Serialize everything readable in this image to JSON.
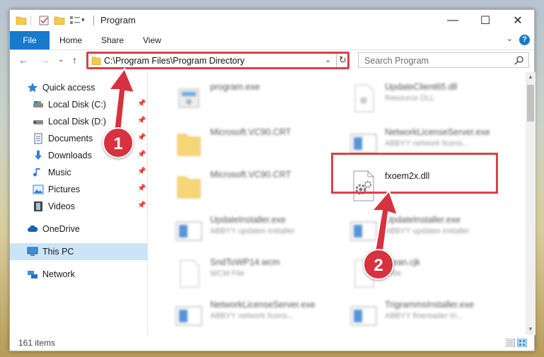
{
  "window": {
    "title": "Program",
    "controls": {
      "minimize": "—",
      "maximize": "☐",
      "close": "✕"
    }
  },
  "ribbon": {
    "tabs": [
      "File",
      "Home",
      "Share",
      "View"
    ],
    "help": "?"
  },
  "address": {
    "path": "C:\\Program Files\\Program Directory",
    "dropdown": "⌄",
    "refresh": "↻"
  },
  "search": {
    "placeholder": "Search Program"
  },
  "nav": {
    "back": "←",
    "forward": "→",
    "recent": "⌄",
    "up": "↑"
  },
  "sidebar": {
    "items": [
      {
        "label": "Quick access",
        "icon": "star-icon"
      },
      {
        "label": "Local Disk (C:)",
        "icon": "drive-icon",
        "pinned": true
      },
      {
        "label": "Local Disk (D:)",
        "icon": "drive-icon",
        "pinned": true
      },
      {
        "label": "Documents",
        "icon": "documents-icon",
        "pinned": true
      },
      {
        "label": "Downloads",
        "icon": "downloads-icon",
        "pinned": true
      },
      {
        "label": "Music",
        "icon": "music-icon",
        "pinned": true
      },
      {
        "label": "Pictures",
        "icon": "pictures-icon",
        "pinned": true
      },
      {
        "label": "Videos",
        "icon": "videos-icon",
        "pinned": true
      },
      {
        "label": "OneDrive",
        "icon": "cloud-icon"
      },
      {
        "label": "This PC",
        "icon": "computer-icon",
        "selected": true
      },
      {
        "label": "Network",
        "icon": "network-icon"
      }
    ]
  },
  "files": [
    {
      "name": "program.exe",
      "sub": "",
      "icon": "exe-icon"
    },
    {
      "name": "UpdateClient65.dll",
      "sub": "Resource DLL",
      "icon": "dll-icon"
    },
    {
      "name": "Microsoft.VC90.CRT",
      "sub": "",
      "icon": "folder-icon"
    },
    {
      "name": "NetworkLicenseServer.exe",
      "sub": "ABBYY network licens...",
      "icon": "app-icon"
    },
    {
      "name": "Microsoft.VC90.CRT",
      "sub": "",
      "icon": "folder-icon"
    },
    {
      "name": "fxoem2x.dll",
      "sub": "",
      "icon": "dll-gear-icon"
    },
    {
      "name": "UpdateInstaller.exe",
      "sub": "ABBYY updates installer",
      "icon": "app-icon"
    },
    {
      "name": "UpdateInstaller.exe",
      "sub": "ABBYY updates installer",
      "icon": "app-icon"
    },
    {
      "name": "SndToWP14.wcm",
      "sub": "WCM File",
      "icon": "file-icon"
    },
    {
      "name": "...ean.cjk",
      "sub": "...file",
      "icon": "file-icon"
    },
    {
      "name": "NetworkLicenseServer.exe",
      "sub": "ABBYY network licens...",
      "icon": "app-icon"
    },
    {
      "name": "TrigrammsInstaller.exe",
      "sub": "ABBYY finereader tri...",
      "icon": "app-icon"
    }
  ],
  "status": {
    "count": "161 items"
  },
  "annotations": {
    "step1": "1",
    "step2": "2"
  },
  "colors": {
    "accent": "#1979ca",
    "annotation": "#d9414b",
    "selection": "#cce4f7"
  }
}
